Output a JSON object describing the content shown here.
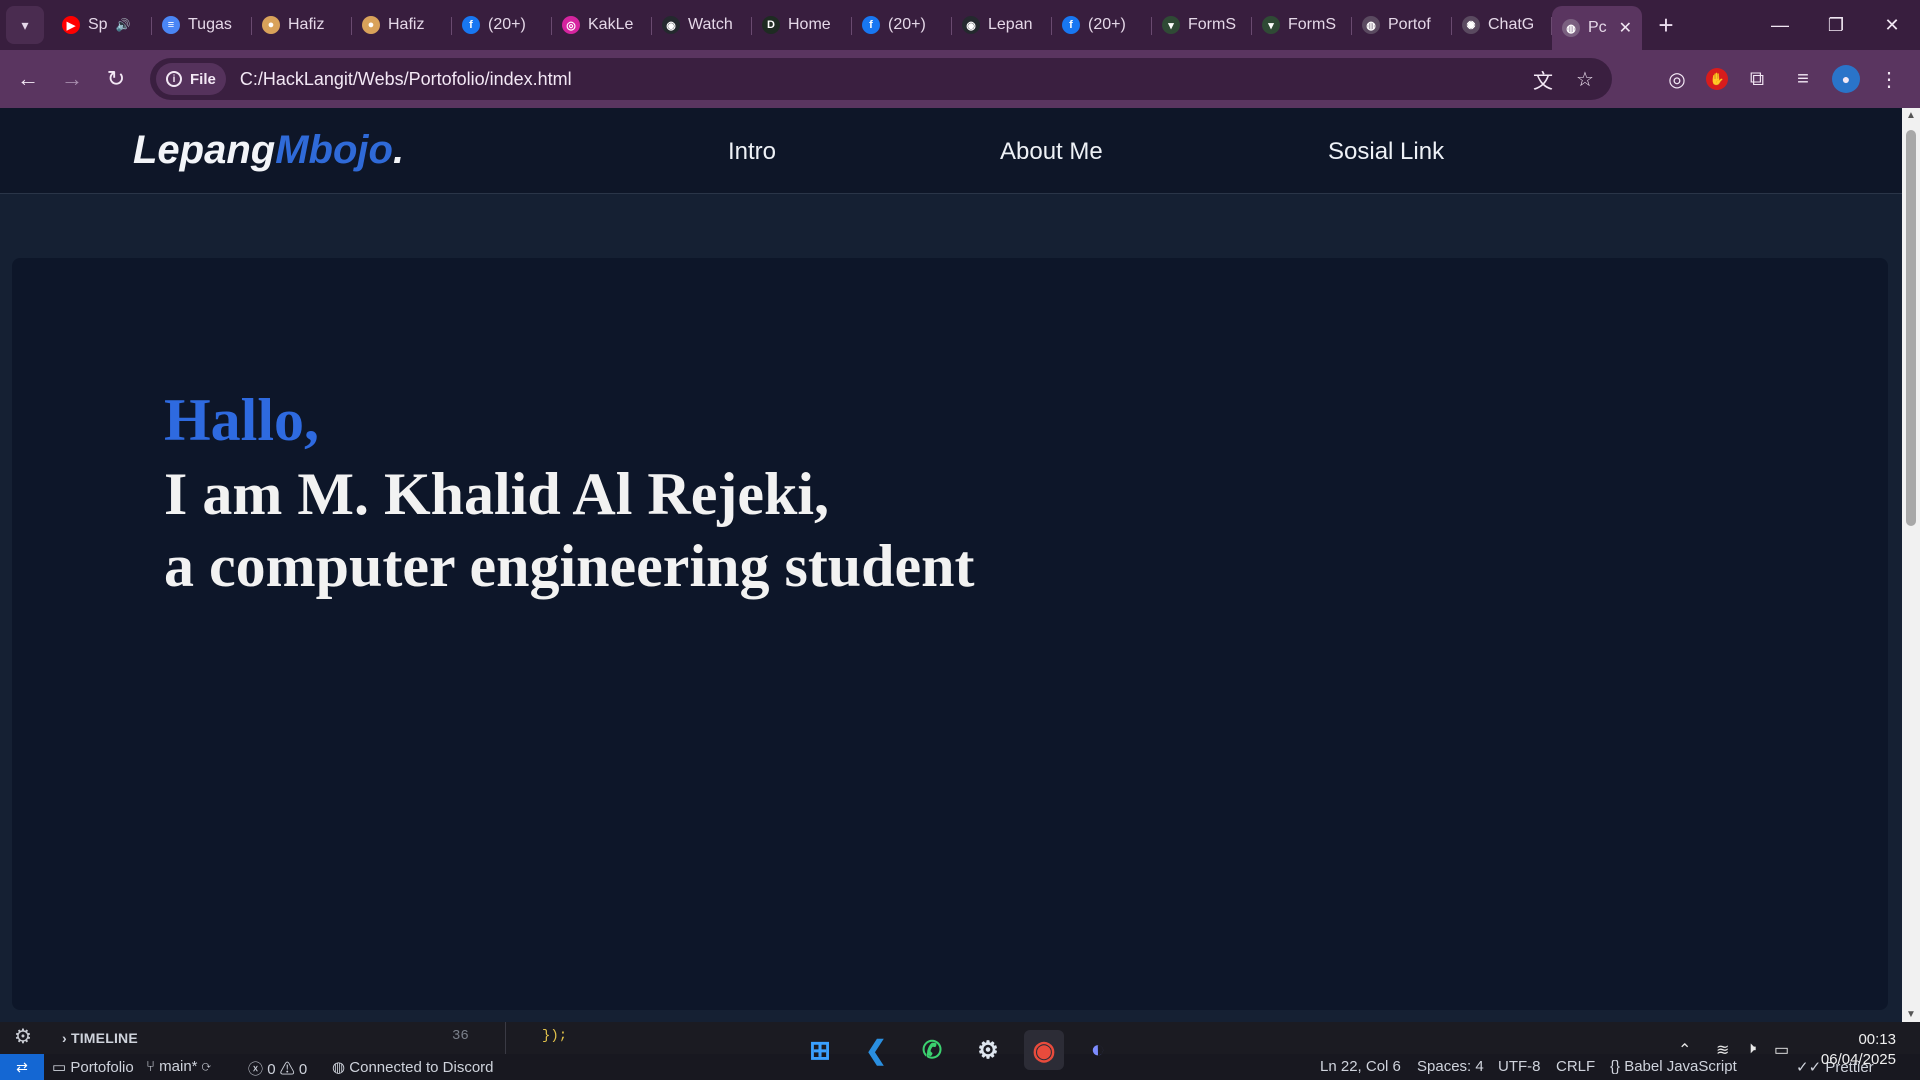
{
  "browser": {
    "tabs": [
      {
        "title": "Sp",
        "icon": "youtube-icon",
        "color": "#ff0000",
        "glyph": "▶",
        "audio": "🔊"
      },
      {
        "title": "Tugas",
        "icon": "docs-icon",
        "color": "#4a86f5",
        "glyph": "≡"
      },
      {
        "title": "Hafiz",
        "icon": "hafiz-icon",
        "color": "#d9a25a",
        "glyph": "●"
      },
      {
        "title": "Hafiz",
        "icon": "hafiz-icon",
        "color": "#d9a25a",
        "glyph": "●"
      },
      {
        "title": "(20+)",
        "icon": "facebook-icon",
        "color": "#1877f2",
        "glyph": "f"
      },
      {
        "title": "KakLe",
        "icon": "instagram-icon",
        "color": "#d6249f",
        "glyph": "◎"
      },
      {
        "title": "Watch",
        "icon": "github-icon",
        "color": "#24292e",
        "glyph": "◉"
      },
      {
        "title": "Home",
        "icon": "d-icon",
        "color": "#1e2b22",
        "glyph": "D"
      },
      {
        "title": "(20+)",
        "icon": "facebook-icon",
        "color": "#1877f2",
        "glyph": "f"
      },
      {
        "title": "Lepan",
        "icon": "github-icon",
        "color": "#24292e",
        "glyph": "◉"
      },
      {
        "title": "(20+)",
        "icon": "facebook-icon",
        "color": "#1877f2",
        "glyph": "f"
      },
      {
        "title": "FormS",
        "icon": "form-icon",
        "color": "#2f4a35",
        "glyph": "▾"
      },
      {
        "title": "FormS",
        "icon": "form-icon",
        "color": "#2f4a35",
        "glyph": "▾"
      },
      {
        "title": "Portof",
        "icon": "globe-icon",
        "color": "#5a4a60",
        "glyph": "◍"
      },
      {
        "title": "ChatG",
        "icon": "chatgpt-icon",
        "color": "#5a4a60",
        "glyph": "✺"
      }
    ],
    "active_tab": {
      "title": "Pc",
      "icon": "globe-icon"
    },
    "new_tab_label": "+",
    "address": {
      "chip": "File",
      "url": "C:/HackLangit/Webs/Portofolio/index.html"
    }
  },
  "site": {
    "logo_a": "Lepang",
    "logo_b": "Mbojo",
    "logo_dot": ".",
    "nav": [
      "Intro",
      "About Me",
      "Sosial Link"
    ],
    "hero": {
      "greeting": "Hallo,",
      "line1": "I am M. Khalid Al Rejeki,",
      "line2": "a computer engineering student"
    },
    "colors": {
      "accent": "#2e6ae0",
      "background": "#0d1629"
    }
  },
  "editor": {
    "panel": "TIMELINE",
    "line_number": "36",
    "code": "});"
  },
  "statusbar": {
    "project": "Portofolio",
    "branch": "main*",
    "errors": "0",
    "warnings": "0",
    "discord": "Connected to Discord",
    "position": "Ln 22, Col 6",
    "spaces": "Spaces: 4",
    "encoding": "UTF-8",
    "eol": "CRLF",
    "language": "Babel JavaScript",
    "formatter": "Prettier"
  },
  "taskbar": {
    "time": "00:13",
    "date": "06/04/2025"
  }
}
